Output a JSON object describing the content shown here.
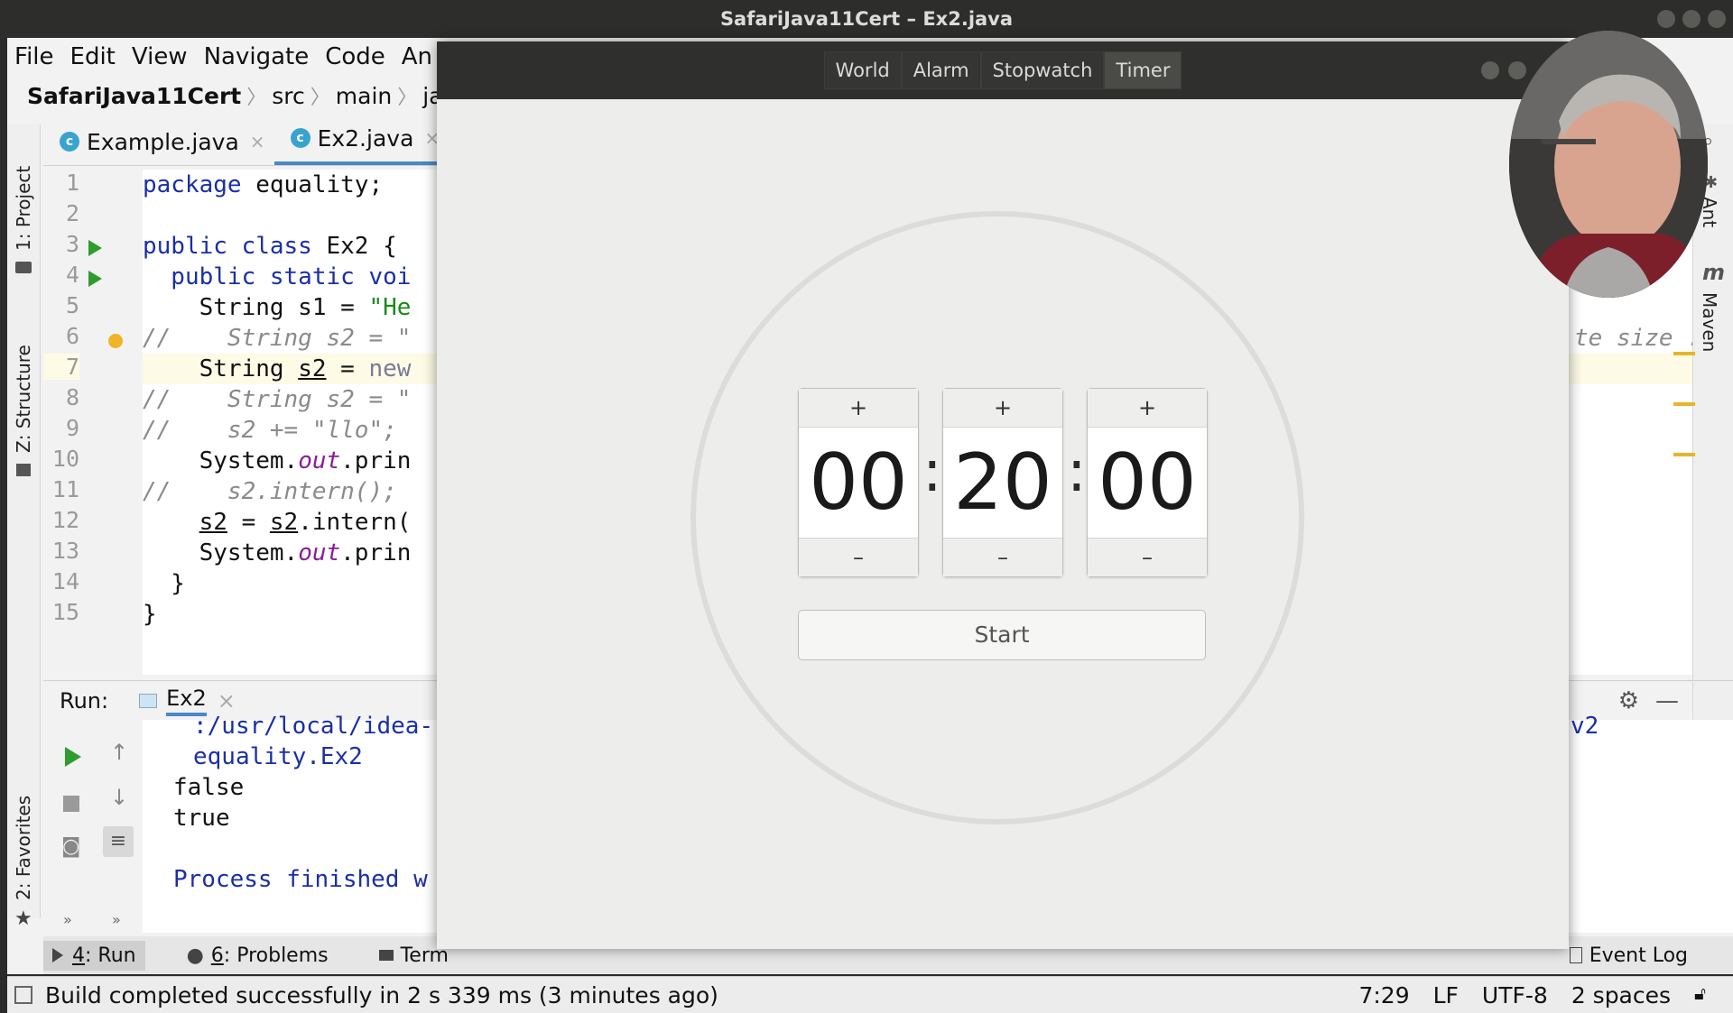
{
  "window": {
    "title": "SafariJava11Cert – Ex2.java"
  },
  "menu": [
    "File",
    "Edit",
    "View",
    "Navigate",
    "Code",
    "An"
  ],
  "breadcrumb": [
    "SafariJava11Cert",
    "src",
    "main",
    "java"
  ],
  "left_tools": {
    "project": "1: Project",
    "structure": "Z: Structure",
    "favorites": "2: Favorites"
  },
  "right_tools": {
    "ant": "Ant",
    "maven": "Maven",
    "maven_icon": "m"
  },
  "editor_tabs": [
    {
      "label": "Example.java",
      "icon": "java-class-icon",
      "active": false
    },
    {
      "label": "Ex2.java",
      "icon": "java-class-icon",
      "active": true
    }
  ],
  "code": {
    "line_numbers": [
      "1",
      "2",
      "3",
      "4",
      "5",
      "6",
      "7",
      "8",
      "9",
      "10",
      "11",
      "12",
      "13",
      "14",
      "15"
    ],
    "l1_kw": "package",
    "l1_rest": " equality;",
    "l3_kw": "public class",
    "l3_rest": " Ex2 {",
    "l4_kw": "  public static voi",
    "l5_a": "    String s1 = ",
    "l5_str": "\"He",
    "l6": "//    String s2 = \"",
    "l7_a": "    String ",
    "l7_var": "s2",
    "l7_b": " = ",
    "l7_kw": "new",
    "l8": "//    String s2 = \"",
    "l9": "//    s2 += \"llo\";",
    "l10_a": "    System.",
    "l10_fld": "out",
    "l10_b": ".prin",
    "l11": "//    s2.intern();",
    "l12_a": "    ",
    "l12_v1": "s2",
    "l12_b": " = ",
    "l12_v2": "s2",
    "l12_c": ".intern(",
    "l13_a": "    System.",
    "l13_fld": "out",
    "l13_b": ".prin",
    "l14": "  }",
    "l15": "}",
    "right_fragment": "te size :"
  },
  "run": {
    "label": "Run:",
    "tab": "Ex2",
    "console": [
      {
        "text": ":/usr/local/idea-",
        "color": "#1a2fa8"
      },
      {
        "text": "equality.Ex2",
        "color": "#1a2fa8"
      },
      {
        "text": "false",
        "color": "#111111"
      },
      {
        "text": "true",
        "color": "#111111"
      },
      {
        "text": "",
        "color": "#111111"
      },
      {
        "text": "Process finished w",
        "color": "#1a2fa8"
      }
    ],
    "right_fragment": "v2"
  },
  "bottom_tabs": [
    {
      "num": "4",
      "label": ": Run",
      "icon": "play-icon",
      "active": true
    },
    {
      "num": "6",
      "label": ": Problems",
      "icon": "info-icon",
      "active": false
    },
    {
      "num": "",
      "label": "Term",
      "icon": "terminal-icon",
      "active": false
    }
  ],
  "event_log": "Event Log",
  "status": {
    "message": "Build completed successfully in 2 s 339 ms (3 minutes ago)",
    "position": "7:29",
    "line_sep": "LF",
    "encoding": "UTF-8",
    "indent": "2 spaces"
  },
  "clocks": {
    "modes": [
      "World",
      "Alarm",
      "Stopwatch",
      "Timer"
    ],
    "active_mode": "Timer",
    "hours": "00",
    "minutes": "20",
    "seconds": "00",
    "plus": "+",
    "minus": "–",
    "colon": ":",
    "start": "Start"
  },
  "colors": {
    "keyword": "#1a2fa8",
    "string": "#1a8a1a",
    "field": "#8b1a9b",
    "accent": "#4a88c7"
  }
}
